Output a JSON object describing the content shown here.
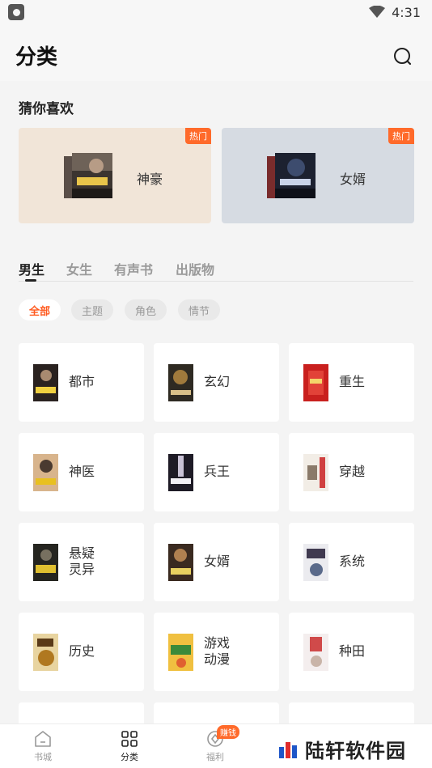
{
  "status_bar": {
    "time": "4:31"
  },
  "header": {
    "title": "分类"
  },
  "guess": {
    "title": "猜你喜欢",
    "cards": [
      {
        "label": "神豪",
        "badge": "热门",
        "color": "#f1e5d8"
      },
      {
        "label": "女婿",
        "badge": "热门",
        "color": "#d6dbe2"
      }
    ]
  },
  "tabs": [
    "男生",
    "女生",
    "有声书",
    "出版物"
  ],
  "chips": [
    "全部",
    "主题",
    "角色",
    "情节"
  ],
  "categories": [
    {
      "label": "都市"
    },
    {
      "label": "玄幻"
    },
    {
      "label": "重生"
    },
    {
      "label": "神医"
    },
    {
      "label": "兵王"
    },
    {
      "label": "穿越"
    },
    {
      "label": "悬疑\n灵异"
    },
    {
      "label": "女婿"
    },
    {
      "label": "系统"
    },
    {
      "label": "历史"
    },
    {
      "label": "游戏\n动漫"
    },
    {
      "label": "种田"
    }
  ],
  "bottom_nav": {
    "items": [
      "书城",
      "分类",
      "福利"
    ],
    "reward_badge": "赚钱"
  },
  "watermark": "陆轩软件园",
  "colors": {
    "accent": "#ff5a1f",
    "hot": "#ff6a2a"
  }
}
